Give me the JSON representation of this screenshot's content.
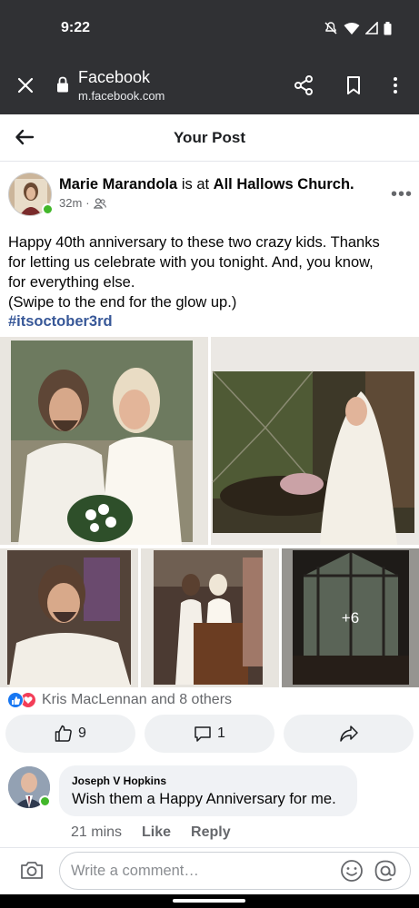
{
  "status_bar": {
    "time": "9:22"
  },
  "browser": {
    "site_title": "Facebook",
    "url": "m.facebook.com"
  },
  "header": {
    "title": "Your Post"
  },
  "post": {
    "author": "Marie Marandola",
    "location_connector": "is at",
    "location": "All Hallows Church.",
    "time_ago": "32m",
    "separator": "·",
    "audience_icon": "friends-icon",
    "text_lines": [
      "Happy 40th anniversary to these two crazy kids. Thanks",
      "for letting us celebrate with you tonight. And, you know,",
      "for everything else.",
      "(Swipe to the end for the glow up.)"
    ],
    "hashtag": "#itsoctober3rd",
    "more_photos_label": "+6"
  },
  "reactions": {
    "summary": "Kris MacLennan and 8 others",
    "like_count": "9",
    "comment_count": "1"
  },
  "comment": {
    "author": "Joseph V Hopkins",
    "text": "Wish them a Happy Anniversary for me.",
    "time_ago": "21 mins",
    "like_label": "Like",
    "reply_label": "Reply"
  },
  "composer": {
    "placeholder": "Write a comment…"
  },
  "colors": {
    "chrome": "#303134",
    "hashtag": "#385898",
    "like_blue": "#1877f2",
    "love_red": "#f33e58",
    "online_green": "#42b72a",
    "pill_bg": "#eff1f3"
  }
}
